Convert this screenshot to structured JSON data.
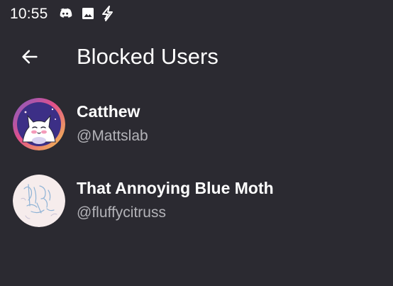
{
  "status_bar": {
    "time": "10:55",
    "icons": [
      "discord-icon",
      "image-icon",
      "bolt-icon"
    ]
  },
  "app_bar": {
    "back_icon": "arrow-left-icon",
    "title": "Blocked Users"
  },
  "blocked_users": [
    {
      "display_name": "Catthew",
      "handle": "@Mattslab",
      "avatar": "cat-avatar"
    },
    {
      "display_name": "That Annoying Blue Moth",
      "handle": "@fluffycitruss",
      "avatar": "sketch-avatar"
    }
  ],
  "colors": {
    "background": "#2b2a31",
    "text_primary": "#ffffff",
    "text_secondary": "#b3b3b8"
  }
}
